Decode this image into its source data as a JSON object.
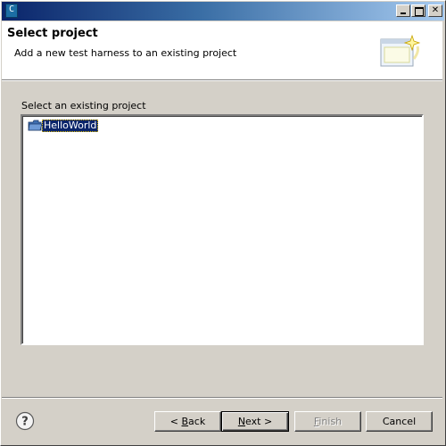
{
  "window": {
    "title_icon": "eclipse-cdt-icon",
    "controls": [
      "minimize",
      "maximize",
      "close"
    ]
  },
  "header": {
    "title": "Select project",
    "description": "Add a new test harness to an existing project",
    "banner_icon": "wizard-banner-icon"
  },
  "content": {
    "list_label": "Select an existing project",
    "projects": [
      {
        "label": "HelloWorld",
        "icon": "project-folder-icon",
        "selected": true
      }
    ]
  },
  "footer": {
    "help_icon": "help-icon",
    "back_prefix": "< ",
    "back_mnemonic": "B",
    "back_rest": "ack",
    "next_mnemonic": "N",
    "next_rest": "ext >",
    "finish_mnemonic": "F",
    "finish_rest": "inish",
    "cancel_label": "Cancel"
  },
  "colors": {
    "titlebar_start": "#0a246a",
    "titlebar_end": "#a6caf0",
    "face": "#d4d0c8",
    "selection": "#0a246a"
  }
}
